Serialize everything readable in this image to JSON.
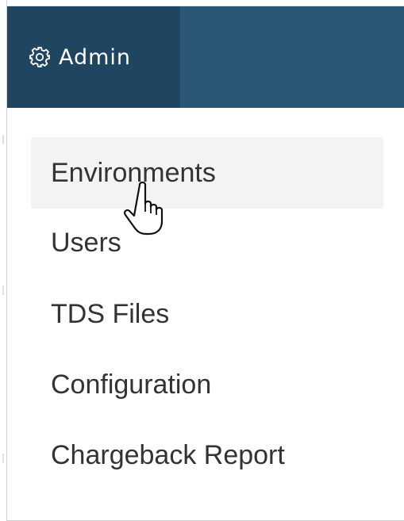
{
  "header": {
    "admin_tab": {
      "icon": "gear-icon",
      "label": "Admin"
    },
    "colors": {
      "bar": "#2b5777",
      "active_tab": "#1f4560",
      "text": "#ffffff"
    }
  },
  "menu": {
    "items": [
      {
        "label": "Environments",
        "hovered": true
      },
      {
        "label": "Users",
        "hovered": false
      },
      {
        "label": "TDS Files",
        "hovered": false
      },
      {
        "label": "Configuration",
        "hovered": false
      },
      {
        "label": "Chargeback Report",
        "hovered": false
      }
    ],
    "hover_background": "#f3f3f3",
    "text_color": "#333333"
  },
  "cursor": {
    "icon": "hand-pointer-cursor-icon"
  }
}
